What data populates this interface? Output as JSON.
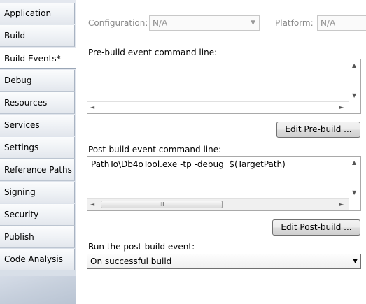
{
  "tabs": [
    {
      "label": "Application"
    },
    {
      "label": "Build"
    },
    {
      "label": "Build Events*"
    },
    {
      "label": "Debug"
    },
    {
      "label": "Resources"
    },
    {
      "label": "Services"
    },
    {
      "label": "Settings"
    },
    {
      "label": "Reference Paths"
    },
    {
      "label": "Signing"
    },
    {
      "label": "Security"
    },
    {
      "label": "Publish"
    },
    {
      "label": "Code Analysis"
    }
  ],
  "active_tab": "Build Events*",
  "topbar": {
    "configuration_label": "Configuration:",
    "configuration_value": "N/A",
    "platform_label": "Platform:",
    "platform_value": "N/A"
  },
  "prebuild": {
    "label": "Pre-build event command line:",
    "value": "",
    "edit_button": "Edit Pre-build ..."
  },
  "postbuild": {
    "label": "Post-build event command line:",
    "value": "PathTo\\Db4oTool.exe -tp -debug  $(TargetPath)",
    "edit_button": "Edit Post-build ..."
  },
  "run_event": {
    "label": "Run the post-build event:",
    "selected": "On successful build"
  },
  "icons": {
    "scroll_up": "▲",
    "scroll_down": "▼",
    "scroll_left": "◄",
    "scroll_right": "►",
    "dropdown": "▼",
    "grip": "III"
  }
}
